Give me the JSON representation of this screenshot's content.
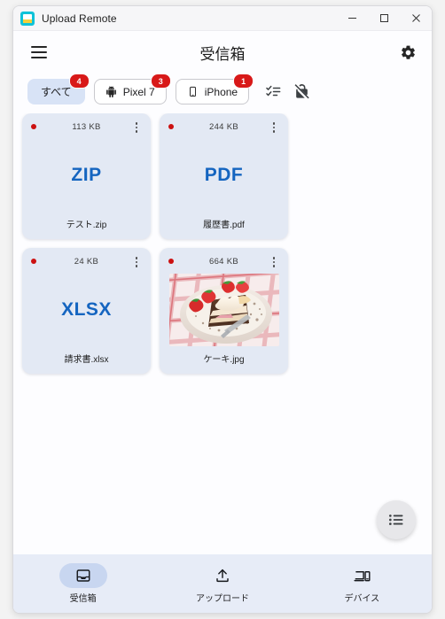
{
  "window": {
    "title": "Upload Remote",
    "app_icon": "app-logo-icon",
    "controls": {
      "minimize": "minimize-button",
      "maximize": "maximize-button",
      "close": "close-button"
    }
  },
  "header": {
    "menu_icon": "hamburger-menu-icon",
    "title": "受信箱",
    "settings_icon": "gear-icon"
  },
  "filters": {
    "chips": [
      {
        "label": "すべて",
        "badge": "4",
        "icon": null,
        "selected": true
      },
      {
        "label": "Pixel 7",
        "badge": "3",
        "icon": "android-icon",
        "selected": false
      },
      {
        "label": "iPhone",
        "badge": "1",
        "icon": "smartphone-icon",
        "selected": false
      }
    ],
    "tools": [
      {
        "icon": "select-checklist-icon"
      },
      {
        "icon": "lock-off-icon"
      }
    ]
  },
  "files": [
    {
      "unread_dot": true,
      "size": "113 KB",
      "kind": "ext",
      "ext": "ZIP",
      "name": "テスト.zip",
      "menu_icon": "more-vert-icon"
    },
    {
      "unread_dot": true,
      "size": "244 KB",
      "kind": "ext",
      "ext": "PDF",
      "name": "履歴書.pdf",
      "menu_icon": "more-vert-icon"
    },
    {
      "unread_dot": true,
      "size": "24 KB",
      "kind": "ext",
      "ext": "XLSX",
      "name": "請求書.xlsx",
      "menu_icon": "more-vert-icon"
    },
    {
      "unread_dot": true,
      "size": "664 KB",
      "kind": "image",
      "ext": "",
      "name": "ケーキ.jpg",
      "thumbnail_alt": "cake-photo-thumbnail",
      "menu_icon": "more-vert-icon"
    }
  ],
  "fab": {
    "icon": "view-list-icon"
  },
  "bottom_nav": [
    {
      "label": "受信箱",
      "icon": "inbox-icon",
      "active": true
    },
    {
      "label": "アップロード",
      "icon": "upload-icon",
      "active": false
    },
    {
      "label": "デバイス",
      "icon": "devices-icon",
      "active": false
    }
  ],
  "colors": {
    "accent_blue": "#1565c0",
    "badge_red": "#d81919",
    "unread_dot_red": "#cc1111",
    "card_bg": "#e3e9f4",
    "chip_selected_bg": "#d8e3f6",
    "bottom_nav_bg": "#e7ecf7",
    "nav_active_pill": "#c8d6f0",
    "page_bg": "#fdfdff"
  }
}
